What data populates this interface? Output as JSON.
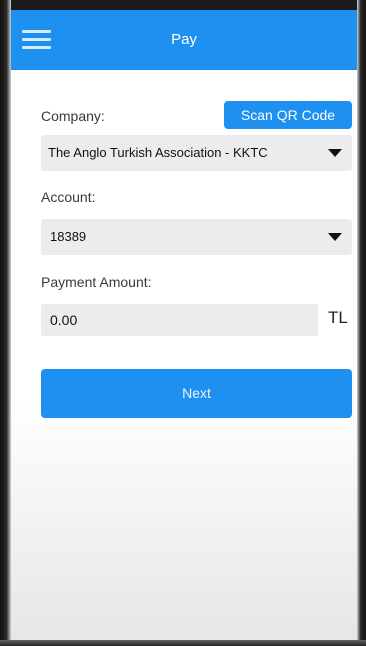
{
  "header": {
    "title": "Pay",
    "menu_icon": "hamburger-menu-icon"
  },
  "form": {
    "company_label": "Company:",
    "scan_qr_label": "Scan QR Code",
    "company_value": "The Anglo Turkish Association - KKTC",
    "account_label": "Account:",
    "account_value": "18389",
    "amount_label": "Payment Amount:",
    "amount_value": "0.00",
    "currency": "TL",
    "next_label": "Next"
  },
  "colors": {
    "accent": "#1e90f0",
    "field_background": "#ececec"
  }
}
